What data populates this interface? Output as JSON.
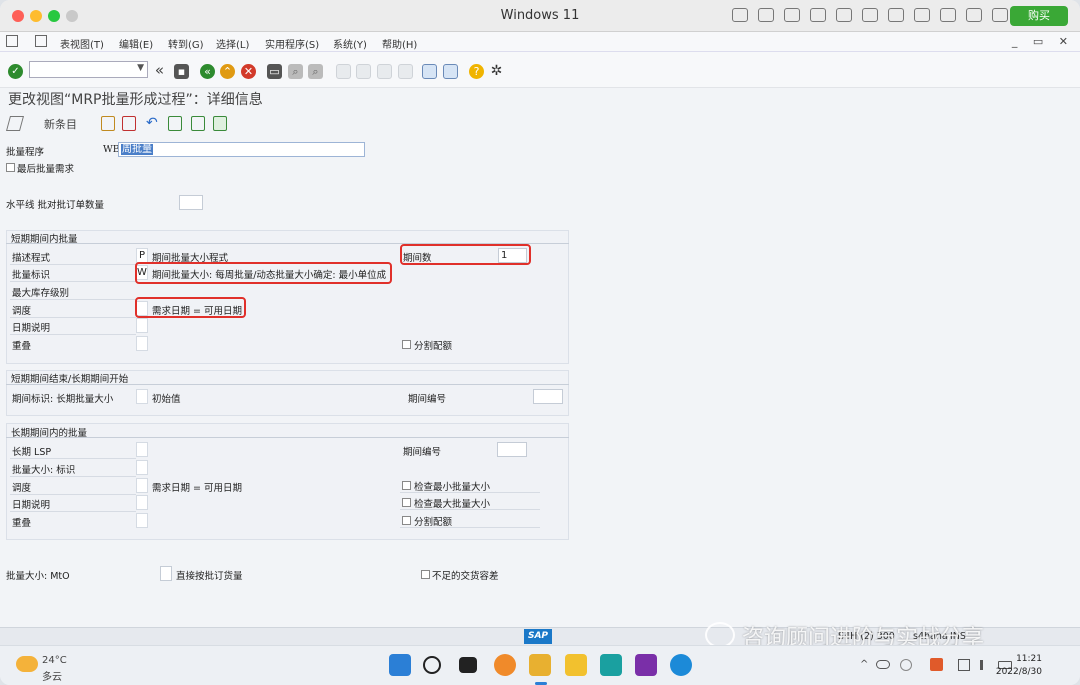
{
  "window": {
    "title": "Windows 11",
    "buy_label": "购买"
  },
  "menu": {
    "items": [
      "表视图(T)",
      "编辑(E)",
      "转到(G)",
      "选择(L)",
      "实用程序(S)",
      "系统(Y)",
      "帮助(H)"
    ],
    "window_controls": "_ ▭ ✕"
  },
  "toolbar": {
    "command_field_value": ""
  },
  "page": {
    "title": "更改视图“MRP批量形成过程”：详细信息"
  },
  "app_toolbar": {
    "new_entry_label": "新条目"
  },
  "header_fields": {
    "lot_procedure_label": "批量程序",
    "lot_procedure_code": "WB",
    "lot_procedure_value": "周批量",
    "last_lot_req_label": "最后批量需求",
    "horizon_label": "水平线 批对批订单数量"
  },
  "short_term": {
    "title": "短期期间内批量",
    "desc_label": "描述程式",
    "desc_code": "P",
    "desc_value": "期间批量大小程式",
    "lot_id_label": "批量标识",
    "lot_id_code": "W",
    "lot_id_value": "期间批量大小: 每周批量/动态批量大小确定: 最小单位成",
    "max_stock_label": "最大库存级别",
    "schedule_label": "调度",
    "schedule_value": "需求日期 = 可用日期",
    "date_desc_label": "日期说明",
    "overlap_label": "重叠",
    "periods_label": "期间数",
    "periods_value": "1",
    "split_quota_label": "分割配额"
  },
  "transition": {
    "title": "短期期间结束/长期期间开始",
    "period_id_label": "期间标识: 长期批量大小",
    "period_id_value": "初始值",
    "period_no_label": "期间编号"
  },
  "long_term": {
    "title": "长期期间内的批量",
    "lsp_label": "长期 LSP",
    "lot_size_id_label": "批量大小: 标识",
    "schedule_label": "调度",
    "schedule_value": "需求日期 = 可用日期",
    "date_desc_label": "日期说明",
    "overlap_label": "重叠",
    "period_no_label": "期间编号",
    "check_min_label": "检查最小批量大小",
    "check_max_label": "检查最大批量大小",
    "split_quota_label": "分割配额"
  },
  "mto": {
    "lot_size_label": "批量大小: MtO",
    "direct_label": "直接按批订货量",
    "tolerance_label": "不足的交货容差"
  },
  "statusbar": {
    "sap_logo": "SAP",
    "system": "S4H (2) 300",
    "host": "s4hana",
    "mode": "INS"
  },
  "watermark": "咨询顾问进阶与实战分享",
  "taskbar": {
    "weather_temp": "24°C",
    "weather_desc": "多云",
    "time": "11:21",
    "date": "2022/8/30",
    "tray_chevron": "^"
  },
  "colors": {
    "highlight_box": "#e0302a",
    "ok_green": "#2e8b2e",
    "buy_green": "#3aa836"
  }
}
